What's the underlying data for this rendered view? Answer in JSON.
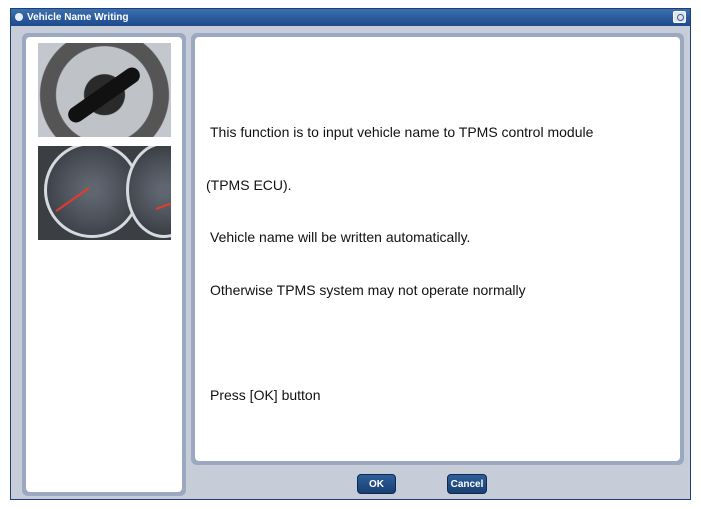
{
  "window": {
    "title": "Vehicle Name Writing"
  },
  "images": {
    "key_icon": "ignition-key-photo",
    "gauge_icon": "instrument-cluster-photo"
  },
  "message": {
    "lines": [
      "This function is to input vehicle name to TPMS control module",
      "(TPMS ECU).",
      "Vehicle name will be written automatically.",
      "Otherwise TPMS system may not operate normally",
      "",
      "Press [OK] button"
    ]
  },
  "buttons": {
    "ok_label": "OK",
    "cancel_label": "Cancel"
  },
  "colors": {
    "titlebar": "#1d4a8c",
    "frame": "#9aa9c0",
    "button": "#183f72"
  }
}
